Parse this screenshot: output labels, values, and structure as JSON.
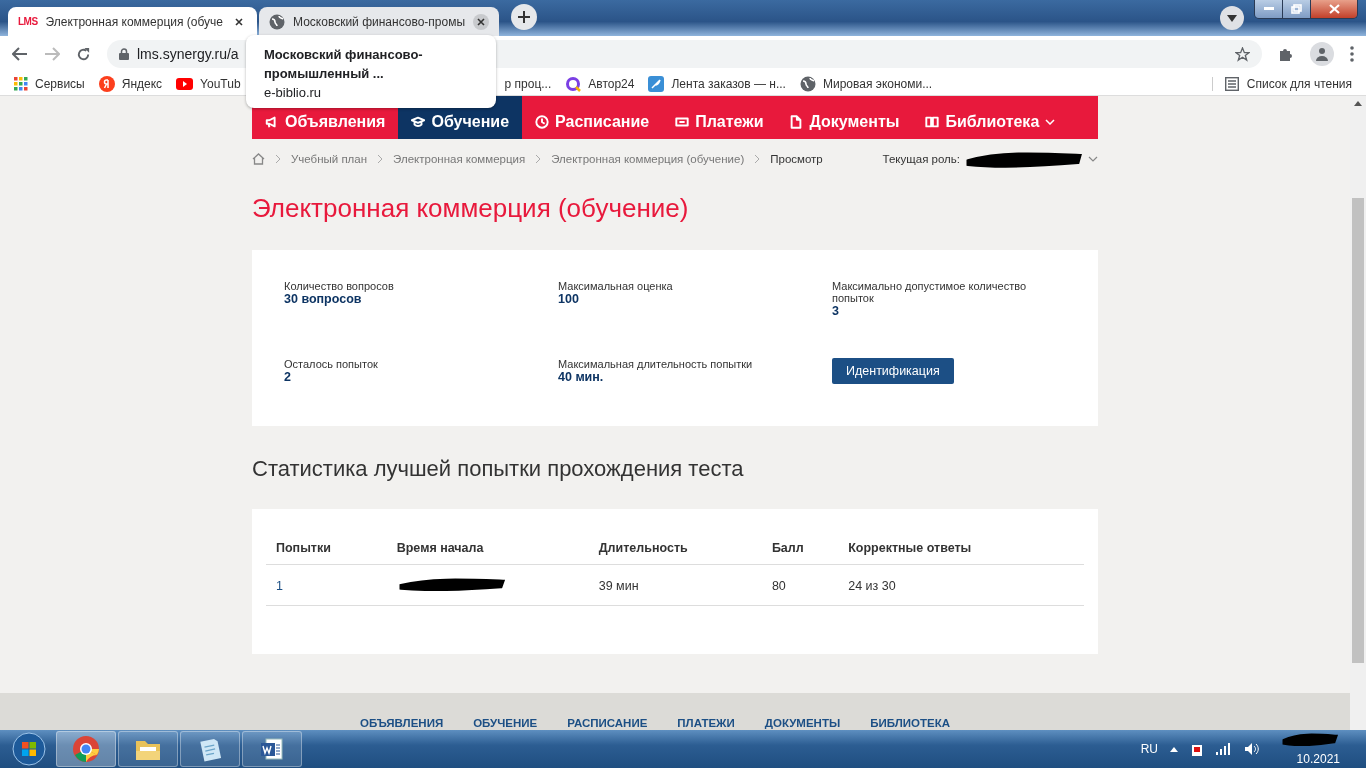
{
  "browser": {
    "tabs": [
      {
        "title": "Электронная коммерция (обуче",
        "selected": true,
        "favicon_text": "LMS",
        "kind": "logo"
      },
      {
        "title": "Московский финансово-промы",
        "selected": false,
        "kind": "globe"
      }
    ],
    "address": "lms.synergy.ru/a",
    "tooltip": {
      "title": "Московский финансово-промышленный ...",
      "domain": "e-biblio.ru"
    },
    "bookmarks": [
      {
        "label": "Сервисы",
        "kind": "apps"
      },
      {
        "label": "Яндекс",
        "kind": "yandex"
      },
      {
        "label": "YouTub",
        "kind": "youtube"
      },
      {
        "label": "р проц...",
        "kind": "none"
      },
      {
        "label": "Автор24",
        "kind": "ring"
      },
      {
        "label": "Лента заказов — н...",
        "kind": "feather"
      },
      {
        "label": "Мировая экономи...",
        "kind": "globe"
      }
    ],
    "reading_list": "Список для чтения"
  },
  "nav": [
    {
      "label": "Объявления",
      "selected": false,
      "kind": "megaphone"
    },
    {
      "label": "Обучение",
      "selected": true,
      "kind": "cap"
    },
    {
      "label": "Расписание",
      "selected": false,
      "kind": "clock"
    },
    {
      "label": "Платежи",
      "selected": false,
      "kind": "card"
    },
    {
      "label": "Документы",
      "selected": false,
      "kind": "doc"
    },
    {
      "label": "Библиотека",
      "selected": false,
      "kind": "book",
      "dropdown": true
    }
  ],
  "breadcrumbs": [
    "Учебный план",
    "Электронная коммерция",
    "Электронная коммерция (обучение)"
  ],
  "breadcrumb_current": "Просмотр",
  "role_label": "Текущая роль:",
  "title": "Электронная коммерция (обучение)",
  "info": [
    {
      "label": "Количество вопросов",
      "value": "30 вопросов"
    },
    {
      "label": "Максимальная оценка",
      "value": "100"
    },
    {
      "label": "Максимально допустимое количество попыток",
      "value": "3"
    },
    {
      "label": "Осталось попыток",
      "value": "2"
    },
    {
      "label": "Максимальная длительность попытки",
      "value": "40 мин."
    }
  ],
  "identify_button": "Идентификация",
  "stats_heading": "Статистика лучшей попытки прохождения теста",
  "table": {
    "columns": [
      "Попытки",
      "Время начала",
      "Длительность",
      "Балл",
      "Корректные ответы"
    ],
    "rows": [
      {
        "attempt": "1",
        "duration": "39 мин",
        "score": "80",
        "correct": "24 из 30"
      }
    ]
  },
  "footer": [
    "ОБЪЯВЛЕНИЯ",
    "ОБУЧЕНИЕ",
    "РАСПИСАНИЕ",
    "ПЛАТЕЖИ",
    "ДОКУМЕНТЫ",
    "БИБЛИОТЕКА"
  ],
  "taskbar": {
    "apps": [
      {
        "kind": "chrome",
        "selected": true
      },
      {
        "kind": "folder",
        "selected": false
      },
      {
        "kind": "notepad",
        "selected": false
      },
      {
        "kind": "word",
        "selected": false
      }
    ],
    "language": "RU",
    "clock": "10.2021"
  }
}
